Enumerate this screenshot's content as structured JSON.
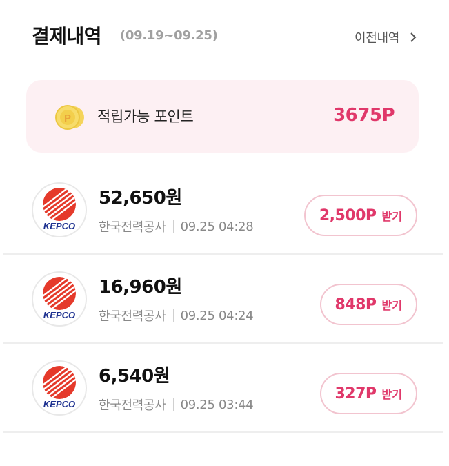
{
  "header": {
    "title": "결제내역",
    "date_range": "(09.19~09.25)",
    "history_link": "이전내역"
  },
  "points": {
    "label": "적립가능 포인트",
    "value": "3675P",
    "coin_letter": "P"
  },
  "logo_text": "KEPCO",
  "transactions": [
    {
      "amount": "52,650원",
      "merchant": "한국전력공사",
      "datetime": "09.25 04:28",
      "reward": "2,500P",
      "reward_action": "받기"
    },
    {
      "amount": "16,960원",
      "merchant": "한국전력공사",
      "datetime": "09.25 04:24",
      "reward": "848P",
      "reward_action": "받기"
    },
    {
      "amount": "6,540원",
      "merchant": "한국전력공사",
      "datetime": "09.25 03:44",
      "reward": "327P",
      "reward_action": "받기"
    }
  ],
  "colors": {
    "accent": "#e0386a",
    "points_bg": "#fdf0f3",
    "button_border": "#f2c4cf",
    "kepco_red": "#e53a2b",
    "kepco_blue": "#1b2f8f"
  },
  "icons": {
    "history_chevron": "chevron-right-icon",
    "coin": "coin-icon",
    "logo": "kepco-logo"
  }
}
